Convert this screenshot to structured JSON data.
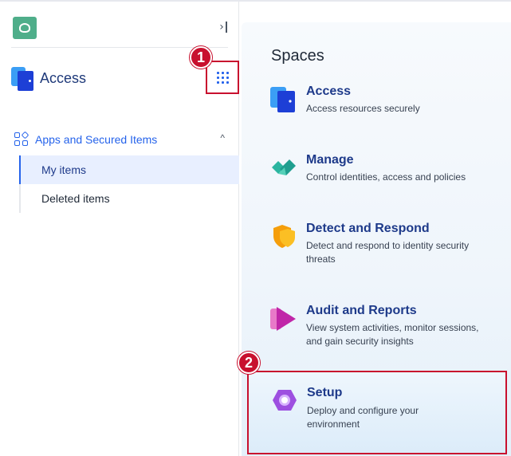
{
  "sidebar": {
    "app_name": "Access",
    "collapse_icon": "collapse-right-icon",
    "apps_menu_icon": "grid-dots-icon",
    "section": {
      "label": "Apps and Secured Items",
      "icon": "apps-grid-icon",
      "chevron": "chevron-up-icon"
    },
    "items": [
      {
        "label": "My items",
        "active": true
      },
      {
        "label": "Deleted items",
        "active": false
      }
    ]
  },
  "markers": [
    {
      "label": "1"
    },
    {
      "label": "2"
    }
  ],
  "spaces": {
    "title": "Spaces",
    "items": [
      {
        "title": "Access",
        "description": "Access resources securely",
        "icon": "access-icon"
      },
      {
        "title": "Manage",
        "description": "Control identities, access and policies",
        "icon": "manage-icon"
      },
      {
        "title": "Detect and Respond",
        "description": "Detect and respond to identity security threats",
        "icon": "shield-icon"
      },
      {
        "title": "Audit and Reports",
        "description": "View system activities, monitor sessions, and gain security insights",
        "icon": "play-icon"
      },
      {
        "title": "Setup",
        "description": "Deploy and configure your environment",
        "icon": "setup-icon"
      }
    ]
  },
  "colors": {
    "accent": "#2563eb",
    "highlight": "#c8102e",
    "brand": "#4fae8a",
    "title": "#1e3a8a"
  }
}
